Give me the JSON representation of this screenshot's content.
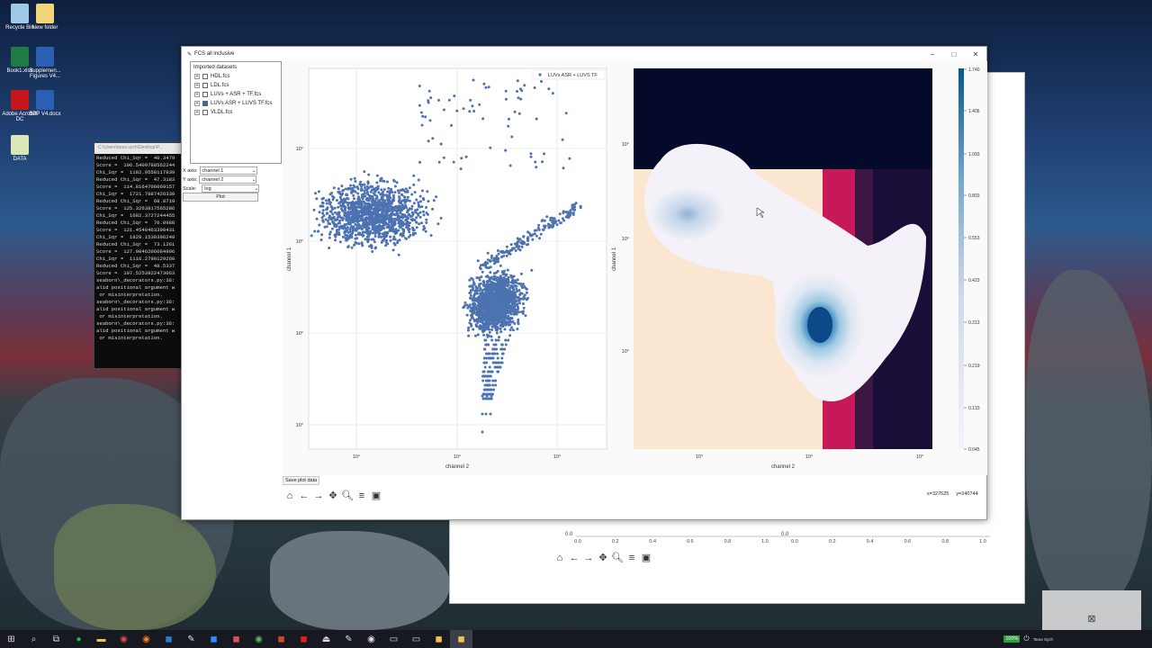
{
  "desktop": {
    "icons": [
      {
        "label": "Recycle Bin",
        "color": "#9fc7e6"
      },
      {
        "label": "New folder",
        "color": "#f2d57a"
      },
      {
        "label": "Book1.xlsx",
        "color": "#1e7b45"
      },
      {
        "label": "Supplemen... Figures V4...",
        "color": "#2b5fb3"
      },
      {
        "label": "Adobe Acrobat DC",
        "color": "#c4161c"
      },
      {
        "label": "SPP V4.docx",
        "color": "#2b5fb3"
      },
      {
        "label": "DATA",
        "color": "#d8e6b8"
      }
    ]
  },
  "terminal": {
    "title": "C:\\Users\\taras.sych\\Desktop\\P...",
    "lines": [
      "Reduced Chi_Sqr =  40.3479",
      "Score =  106.5409788562244",
      "Chi_Sqr =  1182.9558117839",
      "Reduced Chi_Sqr =  47.3183",
      "Score =  114.8164706069157",
      "Chi_Sqr =  1721.7987426339",
      "Reduced Chi_Sqr =  68.8719",
      "Score =  125.3263817565286",
      "Chi_Sqr =  1682.3727244455",
      "Reduced Chi_Sqr =  70.0988",
      "Score =  121.4548463390431",
      "Chi_Sqr =  1828.1538396249",
      "Reduced Chi_Sqr =  73.1261",
      "Score =  127.0046206084996",
      "Chi_Sqr =  1116.2790129260",
      "Reduced Chi_Sqr =  48.5337",
      "Score =  107.5253922473063",
      "seaborn\\_decorators.py:36:",
      "alid positional argument w",
      " or misinterpretation.",
      "seaborn\\_decorators.py:36:",
      "alid positional argument w",
      " or misinterpretation.",
      "seaborn\\_decorators.py:36:",
      "alid positional argument w",
      " or misinterpretation."
    ]
  },
  "window": {
    "title": "FCS all inclusive",
    "minimize": "–",
    "maximize": "□",
    "close": "✕"
  },
  "sidebar": {
    "tree_title": "Imported datasets",
    "datasets": [
      {
        "label": "HDL.fcs",
        "checked": false
      },
      {
        "label": "LDL.fcs",
        "checked": false
      },
      {
        "label": "LUVs + ASR + TF.fcs",
        "checked": false
      },
      {
        "label": "LUVs ASR + LUVS TF.fcs",
        "checked": true
      },
      {
        "label": "VLDL.fcs",
        "checked": false
      }
    ],
    "x_axis_label": "X axis:",
    "x_axis_value": "channel 1",
    "y_axis_label": "Y axis:",
    "y_axis_value": "channel 2",
    "scale_label": "Scale:",
    "scale_value": "log",
    "plot_button": "Plot"
  },
  "scatter": {
    "legend": "LUVs ASR + LUVS TF",
    "xlabel": "channel 2",
    "ylabel": "channel 1",
    "xticks": [
      "10°",
      "10°",
      "10°"
    ],
    "yticks": [
      "10°",
      "10°",
      "10°",
      "10°"
    ],
    "color": "#4c72b0"
  },
  "density": {
    "xlabel": "channel 2",
    "ylabel": "channel 1",
    "xticks": [
      "10°",
      "10°",
      "10°"
    ],
    "yticks": [
      "10°",
      "10°",
      "10°"
    ],
    "colorbar_ticks": [
      "1.740",
      "1.406",
      "1.093",
      "0.803",
      "0.553",
      "0.423",
      "0.313",
      "0.219",
      "0.133",
      "0.045"
    ]
  },
  "footer": {
    "save_plot_data": "Save plot data",
    "coords_x": "x=327625",
    "coords_y": "y=240744"
  },
  "background_window": {
    "xticks": [
      "0.0",
      "0.2",
      "0.4",
      "0.6",
      "0.8",
      "1.0"
    ],
    "yzero": "0.0"
  },
  "taskbar": {
    "battery": "100%",
    "user": "Taras Sych"
  }
}
